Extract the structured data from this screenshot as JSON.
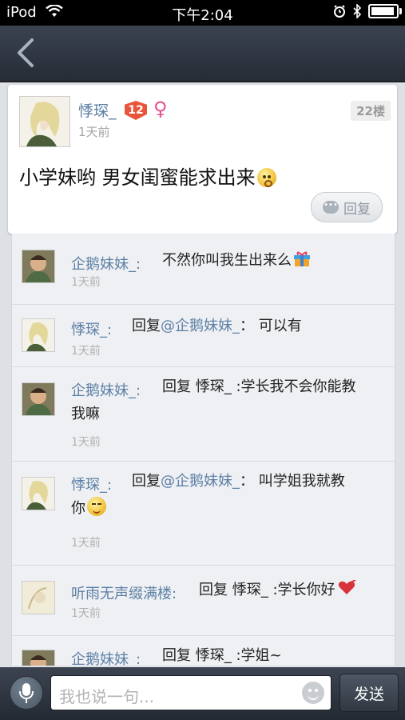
{
  "status_bar": {
    "device": "iPod",
    "time": "下午2:04"
  },
  "post": {
    "author": "悸琛_",
    "level": "12",
    "gender_symbol": "♀",
    "time": "1天前",
    "floor": "22楼",
    "content": "小学妹哟 男女闺蜜能求出来",
    "reply_label": "回复"
  },
  "comments": [
    {
      "name": "企鹅妹妹_:",
      "text": "不然你叫我生出来么",
      "time": "1天前"
    },
    {
      "name": "悸琛_:",
      "text_prefix": "回复",
      "mention": "@企鹅妹妹_",
      "text_suffix": "：  可以有",
      "time": "1天前"
    },
    {
      "name": "企鹅妹妹_:",
      "text_line1": "回复 悸琛_ :学长我不会你能教",
      "text_line2": "我嘛",
      "time": "1天前"
    },
    {
      "name": "悸琛_:",
      "text_prefix": "回复",
      "mention": "@企鹅妹妹_",
      "text_suffix": "：  叫学姐我就教",
      "text_line2": "你",
      "time": "1天前"
    },
    {
      "name": "听雨无声缀满楼:",
      "text": "回复 悸琛_ :学长你好",
      "time": "1天前"
    },
    {
      "name": "企鹅妹妹_:",
      "text": "回复 悸琛_ :学姐~"
    }
  ],
  "composer": {
    "placeholder": "我也说一句...",
    "send_label": "发送"
  },
  "colors": {
    "name_blue": "#5d80a6",
    "nav_dark": "#262c36",
    "badge_red": "#e8553b",
    "gender_pink": "#e8508f"
  }
}
